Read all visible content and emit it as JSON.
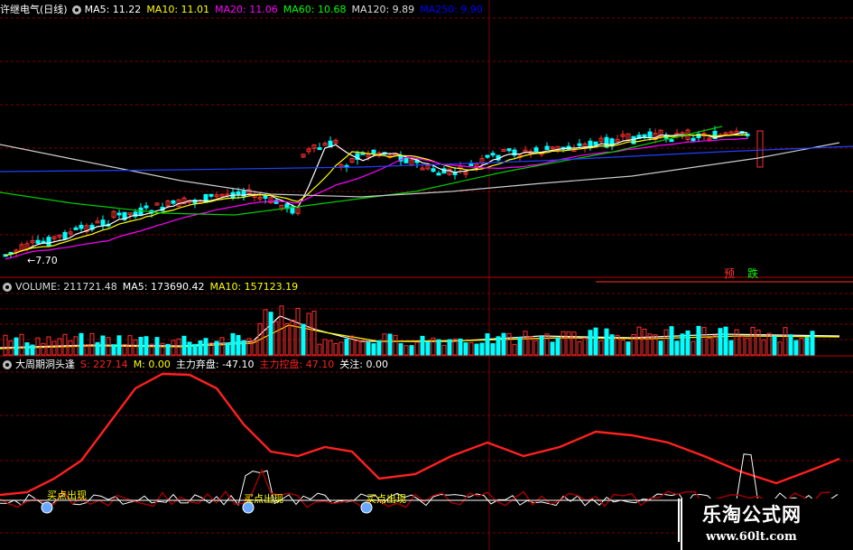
{
  "main_header": {
    "stock_name": "许继电气(日线)",
    "items": [
      {
        "label": "MA5: 11.22",
        "color": "#ffffff"
      },
      {
        "label": "MA10: 11.01",
        "color": "#ffff00"
      },
      {
        "label": "MA20: 11.06",
        "color": "#ff00ff"
      },
      {
        "label": "MA60: 10.68",
        "color": "#00ff00"
      },
      {
        "label": "MA120: 9.89",
        "color": "#dddddd"
      },
      {
        "label": "MA250: 9.90",
        "color": "#0000ff"
      }
    ]
  },
  "price_low_label": "←7.70",
  "hint": {
    "pre": "预",
    "post": "跌"
  },
  "volume_header": {
    "items": [
      {
        "label": "VOLUME: 211721.48",
        "color": "#dddddd"
      },
      {
        "label": "MA5: 173690.42",
        "color": "#ffffff"
      },
      {
        "label": "MA10: 157123.19",
        "color": "#ffff00"
      }
    ]
  },
  "indicator_header": {
    "name": "大周期洞头逢",
    "items": [
      {
        "label": "S: 227.14",
        "color": "#ff2020"
      },
      {
        "label": "M: 0.00",
        "color": "#ffff00"
      },
      {
        "label": "主力弃盘: -47.10",
        "color": "#ffffff"
      },
      {
        "label": "主力控盘: 47.10",
        "color": "#ff2020"
      },
      {
        "label": "关注: 0.00",
        "color": "#ffffff"
      }
    ]
  },
  "signals": [
    "买点出现",
    "买点出现",
    "买点出现"
  ],
  "watermark": {
    "title": "乐淘公式网",
    "url": "www.60lt.com"
  },
  "colors": {
    "up": "#ff3030",
    "down": "#00ffff",
    "bg": "#000000",
    "grid": "#800000"
  }
}
